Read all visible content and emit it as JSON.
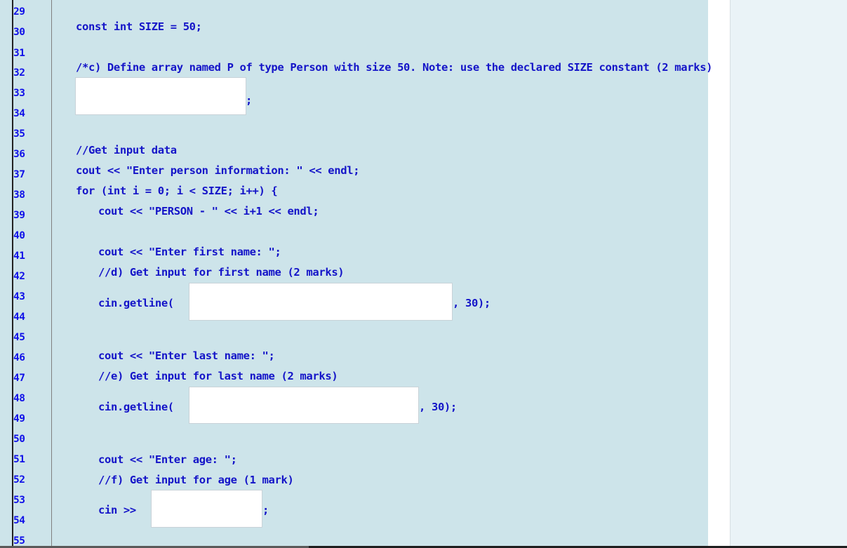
{
  "editor": {
    "line_numbers": [
      "29",
      "30",
      "31",
      "32",
      "33",
      "34",
      "35",
      "36",
      "37",
      "38",
      "39",
      "40",
      "41",
      "42",
      "43",
      "44",
      "45",
      "46",
      "47",
      "48",
      "49",
      "50",
      "51",
      "52",
      "53",
      "54",
      "55"
    ],
    "lines": {
      "const_size": "const int SIZE = 50;",
      "q_c_comment": "/*c) Define array named P of type Person with size 50. Note: use the declared SIZE constant (2 marks)",
      "q_c_suffix": ";",
      "get_input_comment": "//Get input data",
      "cout_enter_person": "cout << \"Enter person information: \" << endl;",
      "for_loop": "for (int i = 0; i < SIZE; i++) {",
      "cout_person_index": "cout << \"PERSON - \" << i+1 << endl;",
      "cout_first_name": "cout << \"Enter first name: \";",
      "q_d_comment": "//d) Get input for first name (2 marks)",
      "q_d_prefix": "cin.getline(",
      "q_d_suffix": ", 30);",
      "cout_last_name": "cout << \"Enter last name: \";",
      "q_e_comment": "//e) Get input for last name (2 marks)",
      "q_e_prefix": "cin.getline(",
      "q_e_suffix": ", 30);",
      "cout_age": "cout << \"Enter age: \";",
      "q_f_comment": "//f) Get input for age (1 mark)",
      "q_f_prefix": "cin >>",
      "q_f_suffix": ";"
    },
    "answers": {
      "c_value": "",
      "d_value": "",
      "e_value": "",
      "f_value": ""
    }
  }
}
